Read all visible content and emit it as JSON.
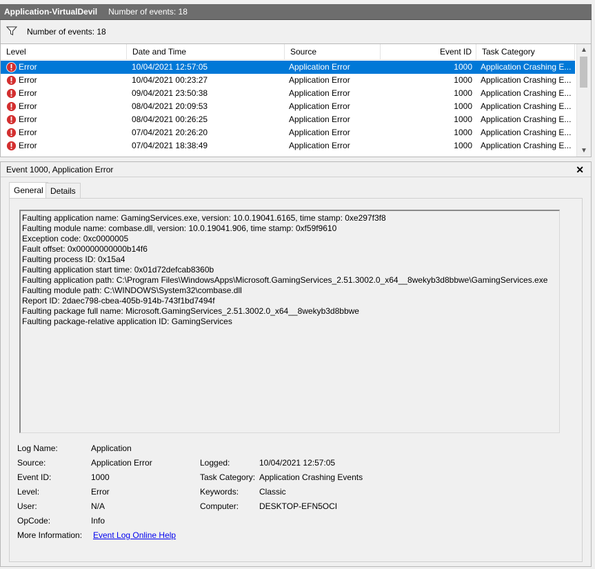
{
  "window": {
    "title": "Application-VirtualDevil",
    "event_count": "Number of events: 18"
  },
  "filter": {
    "icon": "filter-icon",
    "label": "Number of events: 18"
  },
  "grid": {
    "columns": [
      "Level",
      "Date and Time",
      "Source",
      "Event ID",
      "Task Category"
    ],
    "rows": [
      {
        "level": "Error",
        "datetime": "10/04/2021 12:57:05",
        "source": "Application Error",
        "event_id": "1000",
        "category": "Application Crashing E..."
      },
      {
        "level": "Error",
        "datetime": "10/04/2021 00:23:27",
        "source": "Application Error",
        "event_id": "1000",
        "category": "Application Crashing E..."
      },
      {
        "level": "Error",
        "datetime": "09/04/2021 23:50:38",
        "source": "Application Error",
        "event_id": "1000",
        "category": "Application Crashing E..."
      },
      {
        "level": "Error",
        "datetime": "08/04/2021 20:09:53",
        "source": "Application Error",
        "event_id": "1000",
        "category": "Application Crashing E..."
      },
      {
        "level": "Error",
        "datetime": "08/04/2021 00:26:25",
        "source": "Application Error",
        "event_id": "1000",
        "category": "Application Crashing E..."
      },
      {
        "level": "Error",
        "datetime": "07/04/2021 20:26:20",
        "source": "Application Error",
        "event_id": "1000",
        "category": "Application Crashing E..."
      },
      {
        "level": "Error",
        "datetime": "07/04/2021 18:38:49",
        "source": "Application Error",
        "event_id": "1000",
        "category": "Application Crashing E..."
      }
    ],
    "selected_row": 0
  },
  "detail": {
    "title": "Event 1000, Application Error",
    "tabs": [
      "General",
      "Details"
    ],
    "description_lines": [
      "Faulting application name: GamingServices.exe, version: 10.0.19041.6165, time stamp: 0xe297f3f8",
      "Faulting module name: combase.dll, version: 10.0.19041.906, time stamp: 0xf59f9610",
      "Exception code: 0xc0000005",
      "Fault offset: 0x00000000000b14f6",
      "Faulting process ID: 0x15a4",
      "Faulting application start time: 0x01d72defcab8360b",
      "Faulting application path: C:\\Program Files\\WindowsApps\\Microsoft.GamingServices_2.51.3002.0_x64__8wekyb3d8bbwe\\GamingServices.exe",
      "Faulting module path: C:\\WINDOWS\\System32\\combase.dll",
      "Report ID: 2daec798-cbea-405b-914b-743f1bd7494f",
      "Faulting package full name: Microsoft.GamingServices_2.51.3002.0_x64__8wekyb3d8bbwe",
      "Faulting package-relative application ID: GamingServices"
    ],
    "properties": {
      "log_name_label": "Log Name:",
      "log_name": "Application",
      "source_label": "Source:",
      "source": "Application Error",
      "logged_label": "Logged:",
      "logged": "10/04/2021 12:57:05",
      "event_id_label": "Event ID:",
      "event_id": "1000",
      "task_category_label": "Task Category:",
      "task_category": "Application Crashing Events",
      "level_label": "Level:",
      "level": "Error",
      "keywords_label": "Keywords:",
      "keywords": "Classic",
      "user_label": "User:",
      "user": "N/A",
      "computer_label": "Computer:",
      "computer": "DESKTOP-EFN5OCI",
      "opcode_label": "OpCode:",
      "opcode": "Info",
      "more_info_label": "More Information:",
      "more_info_link": "Event Log Online Help"
    }
  },
  "colors": {
    "titlebar": "#6d6d6d",
    "selection": "#0078d7",
    "error_icon": "#d32f2f",
    "link": "#0000ee"
  }
}
